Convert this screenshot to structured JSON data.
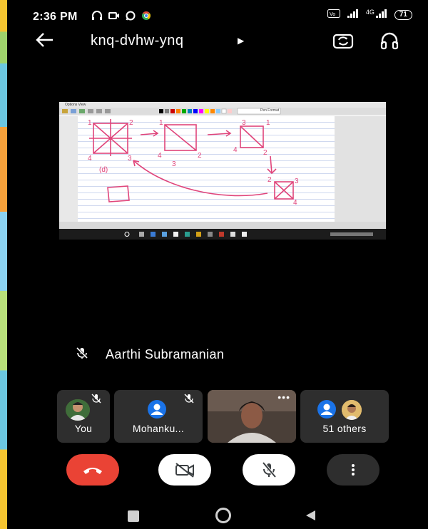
{
  "status_bar": {
    "time": "2:36 PM",
    "network": "4G",
    "battery": "71"
  },
  "header": {
    "meeting_code": "knq-dvhw-ynq"
  },
  "main_stage": {
    "speaker_name": "Aarthi Subramanian",
    "shared_screen": {
      "menu_text": "Options  View",
      "toolbar_field": "Pen Format"
    },
    "sketch_labels": {
      "num_1a": "1",
      "num_2a": "2",
      "num_4a": "4",
      "num_3a": "3",
      "num_1b": "1",
      "num_2b": "2",
      "num_4b": "4",
      "num_3b": "3",
      "num_3c": "3",
      "num_2c": "2",
      "num_1c": "1",
      "num_4c": "4",
      "num_2d": "2",
      "num_3d": "3",
      "num_4d": "4",
      "note": "(d)"
    }
  },
  "participants": [
    {
      "label": "You"
    },
    {
      "label": "Mohanku..."
    },
    {
      "label": ""
    },
    {
      "label": "51 others"
    }
  ],
  "colors": {
    "end_call": "#ea4335",
    "tile_bg": "#2e2e2e",
    "control_white": "#ffffff",
    "avatar_blue": "#1a73e8",
    "sketch_ink": "#e0457b"
  }
}
